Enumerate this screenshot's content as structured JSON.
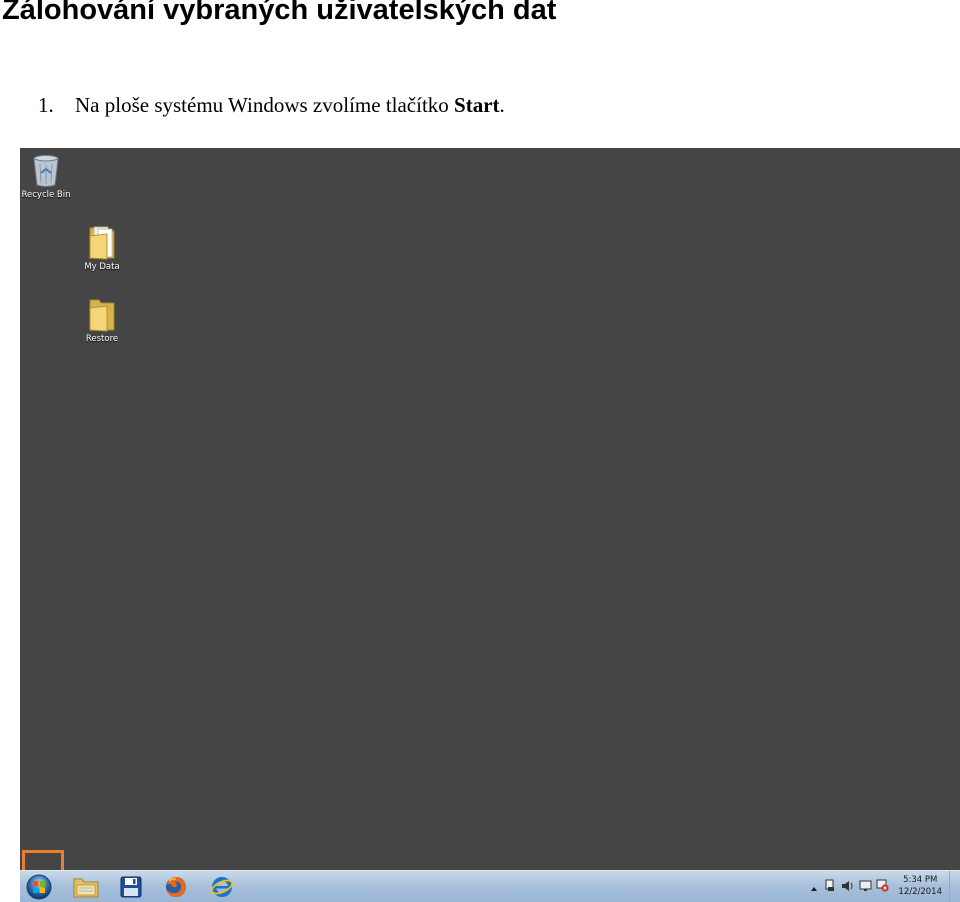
{
  "document": {
    "title": "Zálohování vybraných uživatelských dat",
    "step": {
      "number": "1.",
      "text_before": "Na ploše systému Windows zvolíme tlačítko ",
      "text_bold": "Start",
      "text_after": "."
    }
  },
  "desktop": {
    "background_color": "#454545",
    "icons": [
      {
        "label": "Recycle Bin",
        "icon": "recycle-bin-icon"
      },
      {
        "label": "My Data",
        "icon": "folder-icon"
      },
      {
        "label": "Restore",
        "icon": "folder-icon"
      }
    ]
  },
  "taskbar": {
    "start_highlight_color": "#ed7d31",
    "apps": [
      {
        "name": "windows-explorer",
        "icon": "explorer-folder-icon"
      },
      {
        "name": "save",
        "icon": "floppy-disk-icon"
      },
      {
        "name": "firefox",
        "icon": "firefox-icon"
      },
      {
        "name": "internet-explorer",
        "icon": "internet-explorer-icon"
      }
    ],
    "tray": {
      "time": "5:34 PM",
      "date": "12/2/2014"
    }
  }
}
